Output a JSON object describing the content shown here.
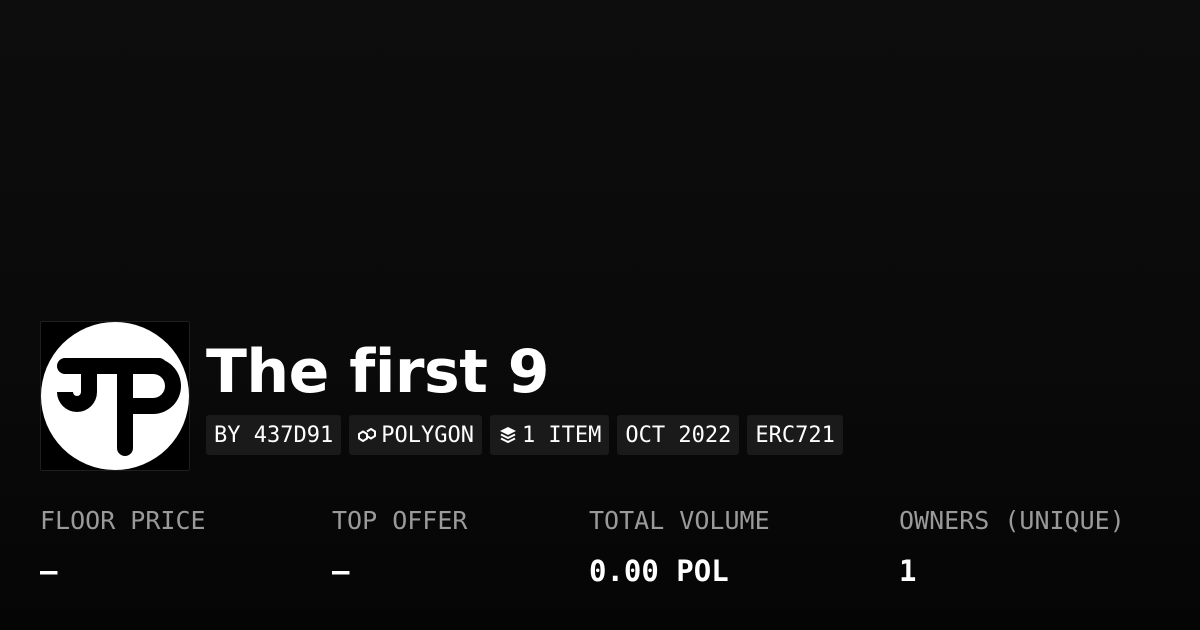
{
  "collection": {
    "title": "The first 9",
    "logo_icon": "pp-monogram-logo"
  },
  "tags": {
    "creator": "BY 437D91",
    "chain_icon": "polygon-icon",
    "chain": "POLYGON",
    "items_icon": "layers-icon",
    "items": "1 ITEM",
    "date": "OCT 2022",
    "standard": "ERC721"
  },
  "stats": {
    "floor_price": {
      "label": "FLOOR PRICE",
      "value": "–"
    },
    "top_offer": {
      "label": "TOP OFFER",
      "value": "–"
    },
    "total_volume": {
      "label": "TOTAL VOLUME",
      "value": "0.00 POL"
    },
    "owners": {
      "label": "OWNERS (UNIQUE)",
      "value": "1"
    }
  },
  "colors": {
    "background": "#0a0a0a",
    "tag_background": "#1a1a1a",
    "label": "#9a9a9a",
    "text": "#ffffff"
  }
}
